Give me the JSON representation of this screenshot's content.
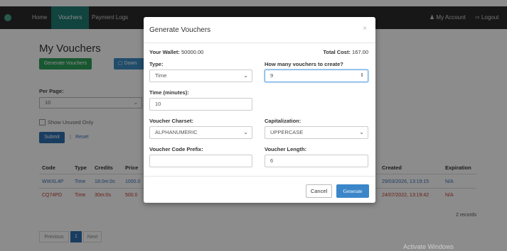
{
  "nav": {
    "home": "Home",
    "vouchers": "Vouchers",
    "payment_logs": "Payment Logs",
    "my_account": "My Account",
    "logout": "Logout"
  },
  "page": {
    "title": "My Vouchers",
    "generate_button": "Generate Vouchers",
    "download_button": "Down",
    "per_page_label": "Per Page:",
    "per_page_value": "10",
    "show_unused_label": "Show Unused Only",
    "submit_label": "Submit",
    "reset_label": "Reset",
    "pager": {
      "previous": "Previous",
      "current": "1",
      "next": "Next"
    },
    "records": "2 records"
  },
  "table": {
    "headers": [
      "Code",
      "Type",
      "Credits",
      "Price",
      "Created",
      "Expiration"
    ],
    "rows": [
      {
        "code": "WWXL4P",
        "type": "Time",
        "credits": "18:0m:0s",
        "price": "1000.0",
        "created": "29/03/2026, 13:19:15",
        "expiration": "N/A"
      },
      {
        "code": "CQ74PD",
        "type": "Time",
        "credits": "30m:0s",
        "price": "500.0",
        "created": "24/07/2022, 13:19:42",
        "expiration": "N/A"
      }
    ]
  },
  "modal": {
    "title": "Generate Vouchers",
    "close": "×",
    "wallet_label": "Your Wallet:",
    "wallet_value": "50000.00",
    "total_cost_label": "Total Cost:",
    "total_cost_value": "167.00",
    "type_label": "Type:",
    "type_value": "Time",
    "count_label": "How many vouchers to create?",
    "count_value": "9",
    "time_label": "Time (minutes):",
    "time_value": "10",
    "charset_label": "Voucher Charset:",
    "charset_value": "ALPHANUMERIC",
    "caps_label": "Capitalization:",
    "caps_value": "UPPERCASE",
    "prefix_label": "Voucher Code Prefix:",
    "prefix_value": "",
    "length_label": "Voucher Length:",
    "length_value": "6",
    "cancel_label": "Cancel",
    "generate_label": "Generate"
  },
  "watermark": "Activate Windows",
  "colors": {
    "navbar": "#2b2b2b",
    "active_tab": "#1f7d72",
    "primary": "#3b86c8",
    "success": "#2f9e5a",
    "danger": "#c0392b"
  }
}
